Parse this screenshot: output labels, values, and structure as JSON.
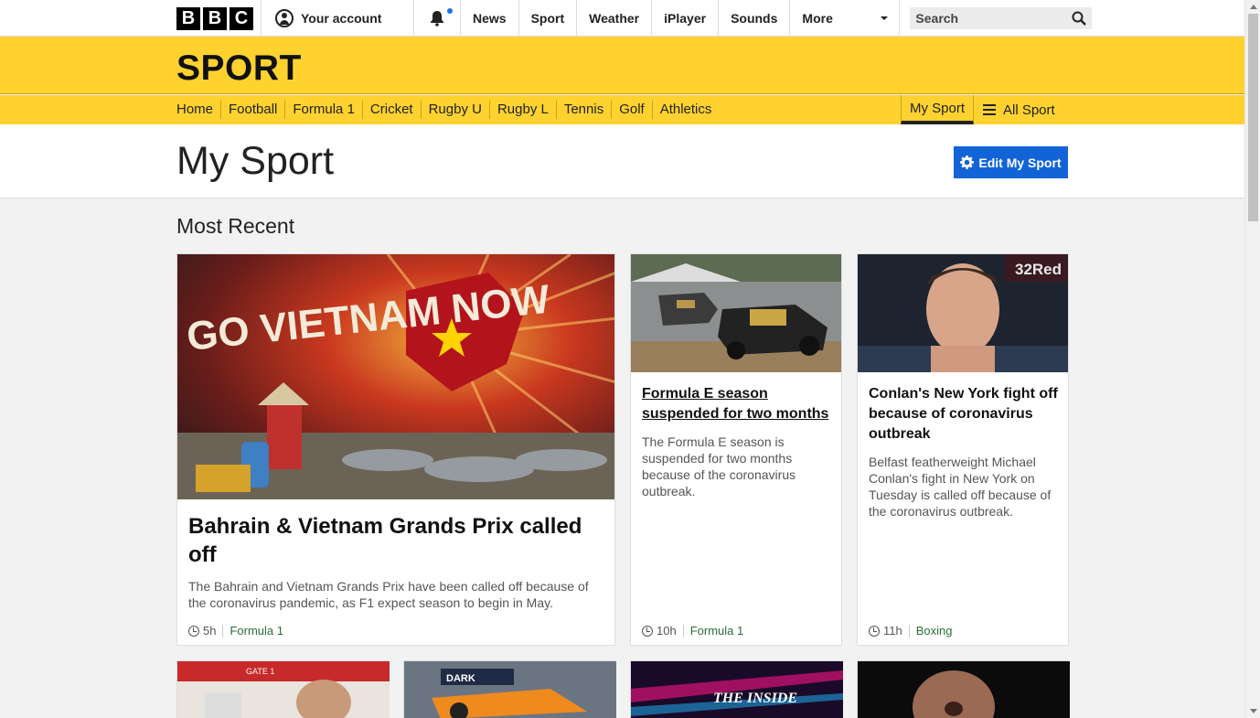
{
  "topbar": {
    "logo_letters": [
      "B",
      "B",
      "C"
    ],
    "account_label": "Your account",
    "nav": [
      "News",
      "Sport",
      "Weather",
      "iPlayer",
      "Sounds"
    ],
    "more_label": "More",
    "search_placeholder": "Search"
  },
  "sport": {
    "title": "SPORT",
    "nav": [
      "Home",
      "Football",
      "Formula 1",
      "Cricket",
      "Rugby U",
      "Rugby L",
      "Tennis",
      "Golf",
      "Athletics"
    ],
    "my_sport": "My Sport",
    "all_sport": "All Sport"
  },
  "page": {
    "title": "My Sport",
    "edit_button": "Edit My Sport",
    "section_title": "Most Recent"
  },
  "cards": [
    {
      "title": "Bahrain & Vietnam Grands Prix called off",
      "summary": "The Bahrain and Vietnam Grands Prix have been called off because of the coronavirus pandemic, as F1 expect season to begin in May.",
      "time": "5h",
      "tag": "Formula 1",
      "image_text": "GO VIETNAM NOW"
    },
    {
      "title": "Formula E season suspended for two months",
      "summary": "The Formula E season is suspended for two months because of the coronavirus outbreak.",
      "time": "10h",
      "tag": "Formula 1"
    },
    {
      "title": "Conlan's New York fight off because of coronavirus outbreak",
      "summary": "Belfast featherweight Michael Conlan's fight in New York on Tuesday is called off because of the coronavirus outbreak.",
      "time": "11h",
      "tag": "Boxing",
      "image_text": "32Red"
    }
  ],
  "row2_images": [
    {
      "text": "GATE 1"
    },
    {
      "text": "DARK"
    },
    {
      "text": "THE INSIDE"
    },
    {
      "text": ""
    }
  ],
  "colors": {
    "sport_yellow": "#ffd230",
    "edit_blue": "#1264d6",
    "tag_green": "#2a6e3a"
  }
}
